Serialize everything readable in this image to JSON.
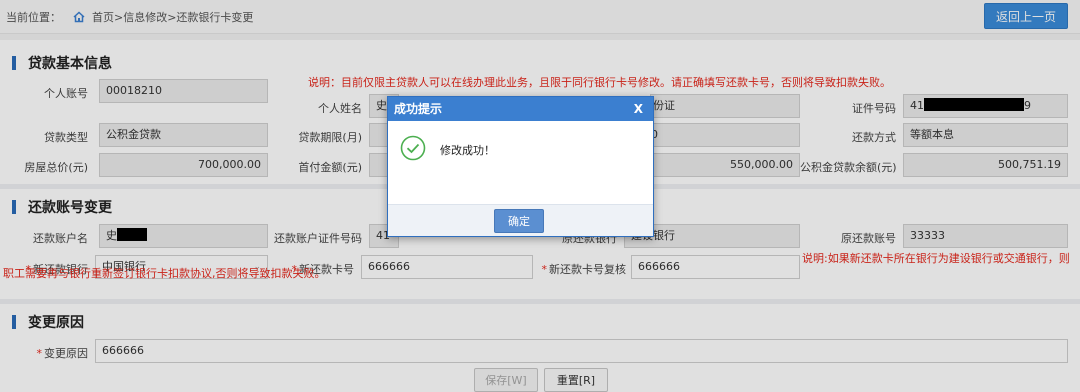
{
  "breadcrumb": {
    "label": "当前位置：",
    "home": "首页",
    "path": ">信息修改>还款银行卡变更"
  },
  "back_button": "返回上一页",
  "loan_info": {
    "title": "贷款基本信息",
    "notice": "说明：目前仅限主贷款人可以在线办理此业务，且限于同行银行卡号修改。请正确填写还款卡号，否则将导致扣款失败。",
    "account_no_label": "个人账号",
    "account_no": "00018210",
    "name_label": "个人姓名",
    "name": "史",
    "id_type_value": "份证",
    "id_no_label": "证件号码",
    "id_no_prefix": "41",
    "id_no_suffix": "9",
    "loan_type_label": "贷款类型",
    "loan_type": "公积金贷款",
    "term_label": "贷款期限(月)",
    "term_value": "0",
    "repay_method_label": "还款方式",
    "repay_method": "等额本息",
    "house_price_label": "房屋总价(元)",
    "house_price": "700,000.00",
    "down_payment_label": "首付金额(元)",
    "loan_amount": "550,000.00",
    "balance_label": "公积金贷款余额(元)",
    "balance": "500,751.19"
  },
  "repay_account": {
    "title": "还款账号变更",
    "holder_label": "还款账户名",
    "holder": "史",
    "holder_id_label": "还款账户证件号码",
    "holder_id": "41",
    "orig_bank_label": "原还款银行",
    "orig_bank": "建设银行",
    "orig_account_label": "原还款账号",
    "orig_account": "33333",
    "new_bank_label": "新还款银行",
    "new_bank": "中国银行",
    "new_card_label": "新还款卡号",
    "new_card": "666666",
    "confirm_card_label": "新还款卡号复核",
    "confirm_card": "666666",
    "notice": "说明:如果新还款卡所在银行为建设银行或交通银行，则职工需要再与银行重新签订银行卡扣款协议,否则将导致扣款失败。"
  },
  "change_reason": {
    "title": "变更原因",
    "label": "变更原因",
    "value": "666666"
  },
  "footer": {
    "save": "保存[W]",
    "reset": "重置[R]"
  },
  "modal": {
    "title": "成功提示",
    "close": "X",
    "message": "修改成功！",
    "confirm": "确定"
  }
}
